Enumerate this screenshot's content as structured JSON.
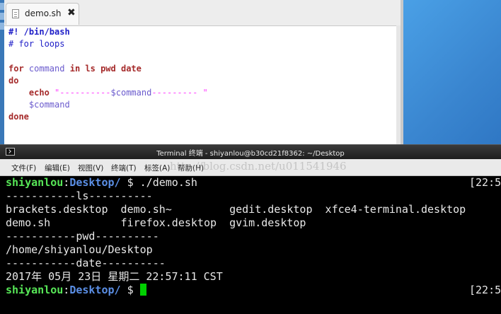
{
  "editor": {
    "tab": {
      "label": "demo.sh",
      "close": "✖"
    },
    "lines": [
      [
        {
          "t": "#! /bin/bash",
          "c": "shebang"
        }
      ],
      [
        {
          "t": "# for loops",
          "c": "cmt"
        }
      ],
      [
        {
          "t": "",
          "c": "plain"
        }
      ],
      [
        {
          "t": "for",
          "c": "kw"
        },
        {
          "t": " command ",
          "c": "plain"
        },
        {
          "t": "in",
          "c": "kw"
        },
        {
          "t": " ",
          "c": "plain"
        },
        {
          "t": "ls pwd date",
          "c": "kw"
        }
      ],
      [
        {
          "t": "do",
          "c": "kw"
        }
      ],
      [
        {
          "t": "    ",
          "c": "plain"
        },
        {
          "t": "echo",
          "c": "kw"
        },
        {
          "t": " \"----------",
          "c": "str"
        },
        {
          "t": "$command",
          "c": "var"
        },
        {
          "t": "--------- \"",
          "c": "str"
        }
      ],
      [
        {
          "t": "    ",
          "c": "plain"
        },
        {
          "t": "$command",
          "c": "var"
        }
      ],
      [
        {
          "t": "done",
          "c": "kw"
        }
      ]
    ]
  },
  "terminal": {
    "title": "Terminal 终端 - shiyanlou@b30cd21f8362: ~/Desktop",
    "menu": [
      "文件(F)",
      "编辑(E)",
      "视图(V)",
      "终端(T)",
      "标签(A)",
      "帮助(H)"
    ],
    "watermark": "http://blog.csdn.net/u011541946",
    "prompt_user": "shiyanlou",
    "prompt_path": "Desktop/",
    "prompt_symbol": " $ ",
    "command": "./demo.sh",
    "timestamp": "[22:5",
    "output": [
      "-----------ls----------",
      "brackets.desktop  demo.sh~         gedit.desktop  xfce4-terminal.desktop",
      "demo.sh           firefox.desktop  gvim.desktop",
      "-----------pwd----------",
      "/home/shiyanlou/Desktop",
      "-----------date----------",
      "2017年 05月 23日 星期二 22:57:11 CST"
    ]
  }
}
